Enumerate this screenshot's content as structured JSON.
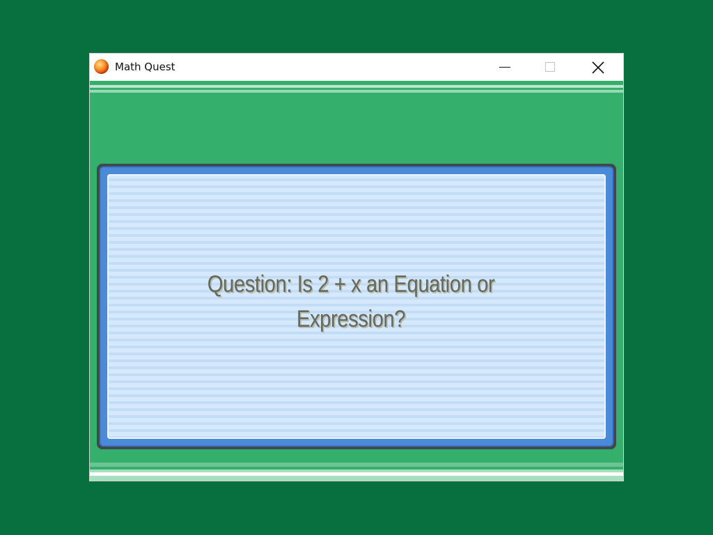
{
  "window": {
    "title": "Math Quest",
    "icon": "orange-orb-icon"
  },
  "controls": {
    "minimize_icon": "minimize-icon",
    "maximize_icon": "maximize-icon",
    "close_icon": "close-icon"
  },
  "dialog": {
    "question": "Question: Is 2 + x an Equation or Expression?"
  },
  "colors": {
    "desktop": "#08703e",
    "game_background": "#35b06c",
    "dialog_border": "#3e4a4c",
    "dialog_frame": "#4a8ad6",
    "dialog_fill": "#d6e8fb",
    "question_text": "#656a5e"
  }
}
